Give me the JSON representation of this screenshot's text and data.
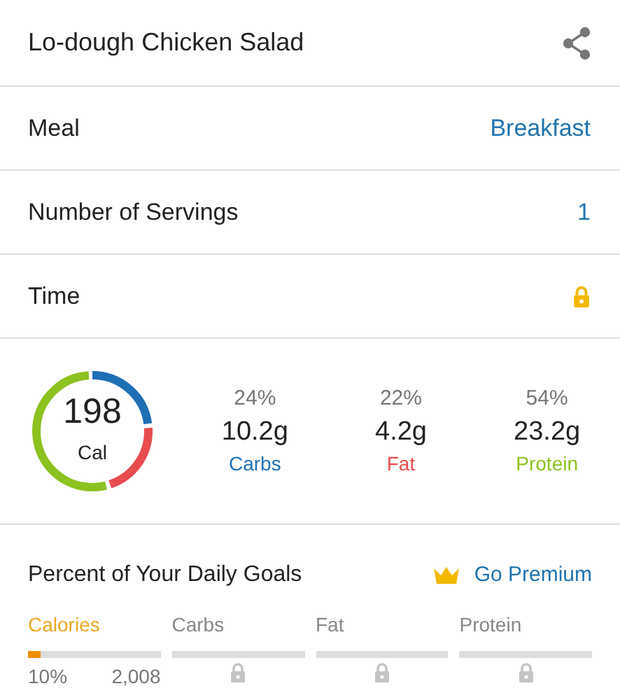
{
  "header": {
    "title": "Lo-dough Chicken Salad"
  },
  "fields": [
    {
      "label": "Meal",
      "value": "Breakfast",
      "locked": false
    },
    {
      "label": "Number of Servings",
      "value": "1",
      "locked": false
    },
    {
      "label": "Time",
      "locked": true
    }
  ],
  "calories": {
    "value": "198",
    "unit": "Cal"
  },
  "macros": [
    {
      "percent": "24%",
      "amount": "10.2g",
      "name": "Carbs",
      "color": "#1f6fb5"
    },
    {
      "percent": "22%",
      "amount": "4.2g",
      "name": "Fat",
      "color": "#e84c4f"
    },
    {
      "percent": "54%",
      "amount": "23.2g",
      "name": "Protein",
      "color": "#8cc21f"
    }
  ],
  "goals": {
    "title": "Percent of Your Daily Goals",
    "premium_link": "Go Premium",
    "items": [
      {
        "name": "Calories",
        "selected": true,
        "locked": false,
        "level": 0.1,
        "percent": "10%",
        "total": "2,008"
      },
      {
        "name": "Carbs",
        "selected": false,
        "locked": true
      },
      {
        "name": "Fat",
        "selected": false,
        "locked": true
      },
      {
        "name": "Protein",
        "selected": false,
        "locked": true
      }
    ]
  }
}
